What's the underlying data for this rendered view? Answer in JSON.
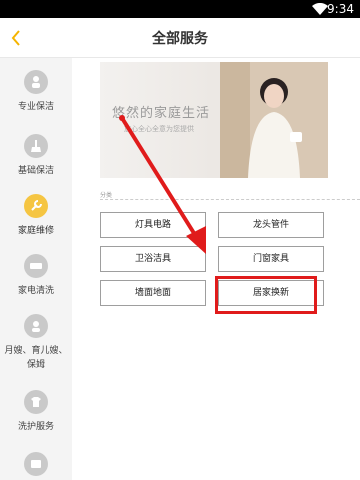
{
  "status_bar": {
    "time": "9:34"
  },
  "header": {
    "title": "全部服务",
    "back_icon": "chevron-left-icon"
  },
  "accent_color": "#f5c542",
  "highlight_color": "#e01b1b",
  "sidebar": {
    "items": [
      {
        "label": "专业保洁",
        "icon": "cleaner-icon",
        "active": false
      },
      {
        "label": "基础保洁",
        "icon": "broom-icon",
        "active": false
      },
      {
        "label": "家庭维修",
        "icon": "wrench-icon",
        "active": true
      },
      {
        "label": "家电清洗",
        "icon": "appliance-icon",
        "active": false
      },
      {
        "label": "月嫂、育儿嫂、保姆",
        "icon": "nanny-icon",
        "active": false
      },
      {
        "label": "洗护服务",
        "icon": "laundry-icon",
        "active": false
      },
      {
        "label": "",
        "icon": "tv-icon",
        "active": false
      }
    ]
  },
  "banner": {
    "headline": "悠然的家庭生活",
    "sub": "放心全心全意为您提供"
  },
  "section_label": "分类",
  "services": [
    {
      "label": "灯具电路"
    },
    {
      "label": "龙头管件"
    },
    {
      "label": "卫浴洁具"
    },
    {
      "label": "门窗家具"
    },
    {
      "label": "墙面地面"
    },
    {
      "label": "居家换新"
    }
  ]
}
